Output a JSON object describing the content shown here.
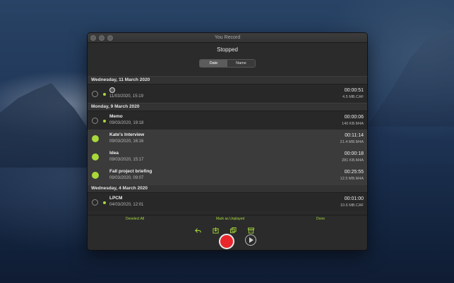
{
  "window": {
    "title": "You Record"
  },
  "header": {
    "status": "Stopped",
    "sort": {
      "options": [
        "Date",
        "Name"
      ],
      "selected": "Date"
    }
  },
  "sections": [
    {
      "title": "Wednesday, 11 March 2020",
      "rows": [
        {
          "name": "",
          "icon": "globe-icon",
          "date": "11/03/2020, 15:19",
          "duration": "00:00:51",
          "size": "4.5 MB.CAF",
          "checked": false,
          "dot": true
        }
      ]
    },
    {
      "title": "Monday, 9 March 2020",
      "rows": [
        {
          "name": "Memo",
          "date": "09/03/2020, 19:18",
          "duration": "00:00:06",
          "size": "140 KB.M4A",
          "checked": false,
          "dot": true
        },
        {
          "name": "Kate's Interview",
          "date": "09/03/2020, 16:16",
          "duration": "00:11:14",
          "size": "21.4 MB.M4A",
          "checked": true,
          "dot": false
        },
        {
          "name": "Idea",
          "date": "09/03/2020, 15:17",
          "duration": "00:00:18",
          "size": "281 KB.M4A",
          "checked": true,
          "dot": false
        },
        {
          "name": "Fall project briefing",
          "date": "09/03/2020, 09:07",
          "duration": "00:25:55",
          "size": "12.5 MB.M4A",
          "checked": true,
          "dot": false
        }
      ]
    },
    {
      "title": "Wednesday, 4 March 2020",
      "rows": [
        {
          "name": "LPCM",
          "date": "04/03/2020, 12:01",
          "duration": "00:01:00",
          "size": "10.6 MB.CAF",
          "checked": false,
          "dot": true
        }
      ]
    }
  ],
  "footer": {
    "deselect_label": "Deselect All",
    "mark_label": "Mark as Unplayed",
    "done_label": "Done",
    "tools": [
      "reply-icon",
      "import-icon",
      "duplicate-icon",
      "archive-icon"
    ],
    "accent": "#a8d93b",
    "record_color": "#e8262b"
  }
}
